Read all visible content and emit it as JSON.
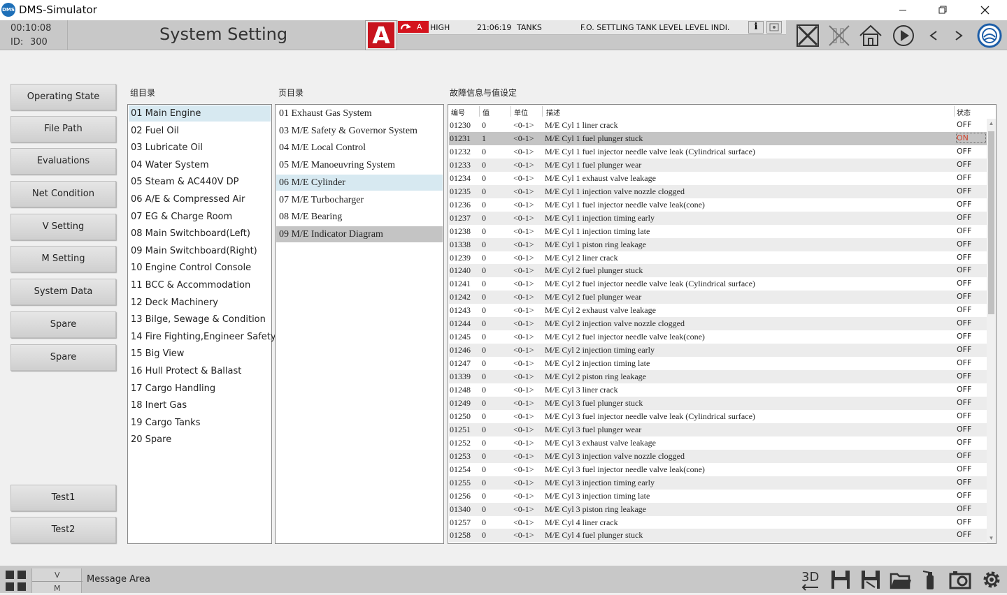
{
  "app": {
    "title": "DMS-Simulator",
    "logo_text": "DMS"
  },
  "header": {
    "sim_time": "00:10:08",
    "id_label": "ID:",
    "id_value": "300",
    "page_title": "System Setting",
    "alarm_letter": "A",
    "alarm": {
      "level": "A",
      "priority": "HIGH",
      "time": "21:06:19",
      "group": "TANKS",
      "description": "F.O. SETTLING TANK LEVEL LEVEL INDI.",
      "info_label": "i"
    }
  },
  "sidebar": {
    "buttons": [
      {
        "label": "Operating State"
      },
      {
        "label": "File Path"
      },
      {
        "label": "Evaluations"
      },
      {
        "label": "Net Condition"
      },
      {
        "label": "V Setting"
      },
      {
        "label": "M Setting"
      },
      {
        "label": "System Data"
      },
      {
        "label": "Spare"
      },
      {
        "label": "Spare"
      }
    ],
    "test_buttons": [
      {
        "label": "Test1"
      },
      {
        "label": "Test2"
      }
    ]
  },
  "group_panel": {
    "label": "组目录",
    "selected_index": 0,
    "items": [
      "01 Main Engine",
      "02 Fuel Oil",
      "03 Lubricate Oil",
      "04 Water System",
      "05 Steam & AC440V DP",
      "06 A/E & Compressed Air",
      "07 EG & Charge Room",
      "08 Main Switchboard(Left)",
      "09 Main Switchboard(Right)",
      "10 Engine Control Console",
      "11 BCC & Accommodation",
      "12 Deck Machinery",
      "13 Bilge, Sewage & Condition",
      "14 Fire Fighting,Engineer Safety",
      "15 Big View",
      "16 Hull Protect & Ballast",
      "17 Cargo Handling",
      "18 Inert Gas",
      "19 Cargo Tanks",
      "20 Spare"
    ]
  },
  "page_panel": {
    "label": "页目录",
    "selected_index": 4,
    "hover_index": 7,
    "items": [
      "01 Exhaust Gas System",
      "03 M/E Safety & Governor System",
      "04 M/E Local Control",
      "05 M/E Manoeuvring System",
      "06 M/E Cylinder",
      "07 M/E Turbocharger",
      "08 M/E Bearing",
      "09 M/E Indicator Diagram"
    ]
  },
  "fault_panel": {
    "label": "故障信息与值设定",
    "columns": {
      "no": "编号",
      "value": "值",
      "unit": "单位",
      "desc": "描述",
      "state": "状态"
    },
    "selected_index": 1,
    "rows": [
      {
        "no": "01230",
        "value": "0",
        "unit": "<0-1>",
        "desc": "M/E Cyl 1 liner crack",
        "state": "OFF"
      },
      {
        "no": "01231",
        "value": "1",
        "unit": "<0-1>",
        "desc": "M/E Cyl 1 fuel plunger stuck",
        "state": "ON"
      },
      {
        "no": "01232",
        "value": "0",
        "unit": "<0-1>",
        "desc": "M/E Cyl 1 fuel injector needle valve leak (Cylindrical surface)",
        "state": "OFF"
      },
      {
        "no": "01233",
        "value": "0",
        "unit": "<0-1>",
        "desc": "M/E Cyl 1 fuel plunger wear",
        "state": "OFF"
      },
      {
        "no": "01234",
        "value": "0",
        "unit": "<0-1>",
        "desc": "M/E Cyl 1 exhaust valve leakage",
        "state": "OFF"
      },
      {
        "no": "01235",
        "value": "0",
        "unit": "<0-1>",
        "desc": "M/E Cyl 1 injection valve nozzle clogged",
        "state": "OFF"
      },
      {
        "no": "01236",
        "value": "0",
        "unit": "<0-1>",
        "desc": "M/E Cyl 1 fuel injector needle valve leak(cone)",
        "state": "OFF"
      },
      {
        "no": "01237",
        "value": "0",
        "unit": "<0-1>",
        "desc": "M/E Cyl 1 injection timing early",
        "state": "OFF"
      },
      {
        "no": "01238",
        "value": "0",
        "unit": "<0-1>",
        "desc": "M/E Cyl 1 injection timing late",
        "state": "OFF"
      },
      {
        "no": "01338",
        "value": "0",
        "unit": "<0-1>",
        "desc": "M/E Cyl 1 piston ring leakage",
        "state": "OFF"
      },
      {
        "no": "01239",
        "value": "0",
        "unit": "<0-1>",
        "desc": "M/E Cyl 2 liner crack",
        "state": "OFF"
      },
      {
        "no": "01240",
        "value": "0",
        "unit": "<0-1>",
        "desc": "M/E Cyl 2 fuel plunger stuck",
        "state": "OFF"
      },
      {
        "no": "01241",
        "value": "0",
        "unit": "<0-1>",
        "desc": "M/E Cyl 2 fuel injector needle valve leak (Cylindrical surface)",
        "state": "OFF"
      },
      {
        "no": "01242",
        "value": "0",
        "unit": "<0-1>",
        "desc": "M/E Cyl 2 fuel plunger wear",
        "state": "OFF"
      },
      {
        "no": "01243",
        "value": "0",
        "unit": "<0-1>",
        "desc": "M/E Cyl 2 exhaust valve leakage",
        "state": "OFF"
      },
      {
        "no": "01244",
        "value": "0",
        "unit": "<0-1>",
        "desc": "M/E Cyl 2 injection valve nozzle clogged",
        "state": "OFF"
      },
      {
        "no": "01245",
        "value": "0",
        "unit": "<0-1>",
        "desc": "M/E Cyl 2 fuel injector needle valve leak(cone)",
        "state": "OFF"
      },
      {
        "no": "01246",
        "value": "0",
        "unit": "<0-1>",
        "desc": "M/E Cyl 2 injection timing early",
        "state": "OFF"
      },
      {
        "no": "01247",
        "value": "0",
        "unit": "<0-1>",
        "desc": "M/E Cyl 2 injection timing late",
        "state": "OFF"
      },
      {
        "no": "01339",
        "value": "0",
        "unit": "<0-1>",
        "desc": "M/E Cyl 2 piston ring leakage",
        "state": "OFF"
      },
      {
        "no": "01248",
        "value": "0",
        "unit": "<0-1>",
        "desc": "M/E Cyl 3 liner crack",
        "state": "OFF"
      },
      {
        "no": "01249",
        "value": "0",
        "unit": "<0-1>",
        "desc": "M/E Cyl 3 fuel plunger stuck",
        "state": "OFF"
      },
      {
        "no": "01250",
        "value": "0",
        "unit": "<0-1>",
        "desc": "M/E Cyl 3 fuel injector needle valve leak (Cylindrical surface)",
        "state": "OFF"
      },
      {
        "no": "01251",
        "value": "0",
        "unit": "<0-1>",
        "desc": "M/E Cyl 3 fuel plunger wear",
        "state": "OFF"
      },
      {
        "no": "01252",
        "value": "0",
        "unit": "<0-1>",
        "desc": "M/E Cyl 3 exhaust valve leakage",
        "state": "OFF"
      },
      {
        "no": "01253",
        "value": "0",
        "unit": "<0-1>",
        "desc": "M/E Cyl 3 injection valve nozzle clogged",
        "state": "OFF"
      },
      {
        "no": "01254",
        "value": "0",
        "unit": "<0-1>",
        "desc": "M/E Cyl 3 fuel injector needle valve leak(cone)",
        "state": "OFF"
      },
      {
        "no": "01255",
        "value": "0",
        "unit": "<0-1>",
        "desc": "M/E Cyl 3 injection timing early",
        "state": "OFF"
      },
      {
        "no": "01256",
        "value": "0",
        "unit": "<0-1>",
        "desc": "M/E Cyl 3 injection timing late",
        "state": "OFF"
      },
      {
        "no": "01340",
        "value": "0",
        "unit": "<0-1>",
        "desc": "M/E Cyl 3 piston ring leakage",
        "state": "OFF"
      },
      {
        "no": "01257",
        "value": "0",
        "unit": "<0-1>",
        "desc": "M/E Cyl 4 liner crack",
        "state": "OFF"
      },
      {
        "no": "01258",
        "value": "0",
        "unit": "<0-1>",
        "desc": "M/E Cyl 4 fuel plunger stuck",
        "state": "OFF"
      }
    ]
  },
  "bottombar": {
    "vm_v": "V",
    "vm_m": "M",
    "message_area": "Message Area",
    "icon_3d_label": "3D"
  },
  "colors": {
    "alarm_red": "#c8141e",
    "selection_blue": "#d7e9f1",
    "on_state": "#d0402a"
  }
}
